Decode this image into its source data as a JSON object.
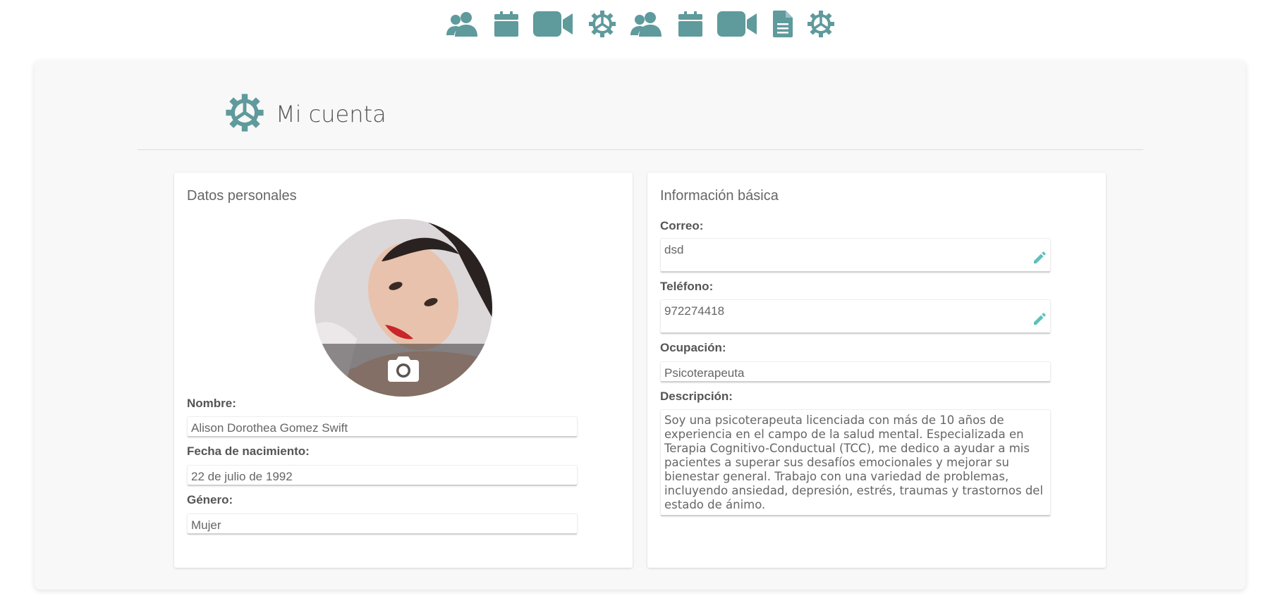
{
  "colors": {
    "accent": "#5f9a9c",
    "edit": "#5fbfbb",
    "background": "#f8f8f8"
  },
  "nav": {
    "icons": [
      "users-icon",
      "calendar-icon",
      "video-icon",
      "settings-icon",
      "users-icon",
      "calendar-icon",
      "video-icon",
      "document-icon",
      "settings-icon"
    ]
  },
  "header": {
    "title": "Mi cuenta",
    "icon": "settings-icon"
  },
  "personal": {
    "title": "Datos personales",
    "avatar_action_icon": "camera-icon",
    "name_label": "Nombre:",
    "name_value": "Alison Dorothea Gomez Swift",
    "birth_label": "Fecha de nacimiento:",
    "birth_value": "22 de julio de 1992",
    "gender_label": "Género:",
    "gender_value": "Mujer"
  },
  "basic": {
    "title": "Información básica",
    "email_label": "Correo:",
    "email_value": "dsd",
    "phone_label": "Teléfono:",
    "phone_value": "972274418",
    "occupation_label": "Ocupación:",
    "occupation_value": "Psicoterapeuta",
    "description_label": "Descripción:",
    "description_value": "Soy una psicoterapeuta licenciada con más de 10 años de\nexperiencia en el campo de la salud mental. Especializada en\nTerapia Cognitivo-Conductual (TCC), me dedico a ayudar a mis\npacientes a superar sus desafíos emocionales y mejorar su\nbienestar general. Trabajo con una variedad de problemas,\nincluyendo ansiedad, depresión, estrés, traumas y trastornos del\nestado de ánimo."
  }
}
